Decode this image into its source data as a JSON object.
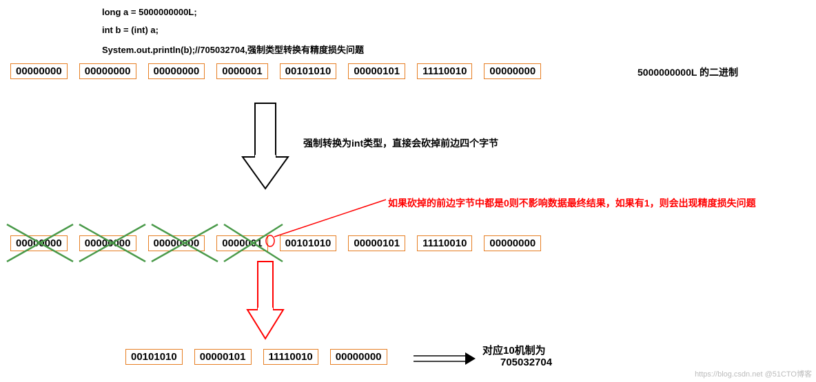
{
  "code": {
    "line1": "long a = 5000000000L;",
    "line2": "int b = (int) a;",
    "line3": "System.out.println(b);//705032704,强制类型转换有精度损失问题"
  },
  "row1": {
    "b0": "00000000",
    "b1": "00000000",
    "b2": "00000000",
    "b3": "0000001",
    "b4": "00101010",
    "b5": "00000101",
    "b6": "11110010",
    "b7": "00000000"
  },
  "row1_label": "5000000000L 的二进制",
  "step1_label": "强制转换为int类型，直接会砍掉前边四个字节",
  "step2_label": "如果砍掉的前边字节中都是0则不影响数据最终结果，如果有1，则会出现精度损失问题",
  "row2": {
    "b0": "00000000",
    "b1": "00000000",
    "b2": "00000000",
    "b3": "0000001",
    "b4": "00101010",
    "b5": "00000101",
    "b6": "11110010",
    "b7": "00000000"
  },
  "row3": {
    "b0": "00101010",
    "b1": "00000101",
    "b2": "11110010",
    "b3": "00000000"
  },
  "result_label": "对应10机制为",
  "result_value": "705032704",
  "watermark": "https://blog.csdn.net @51CTO博客"
}
